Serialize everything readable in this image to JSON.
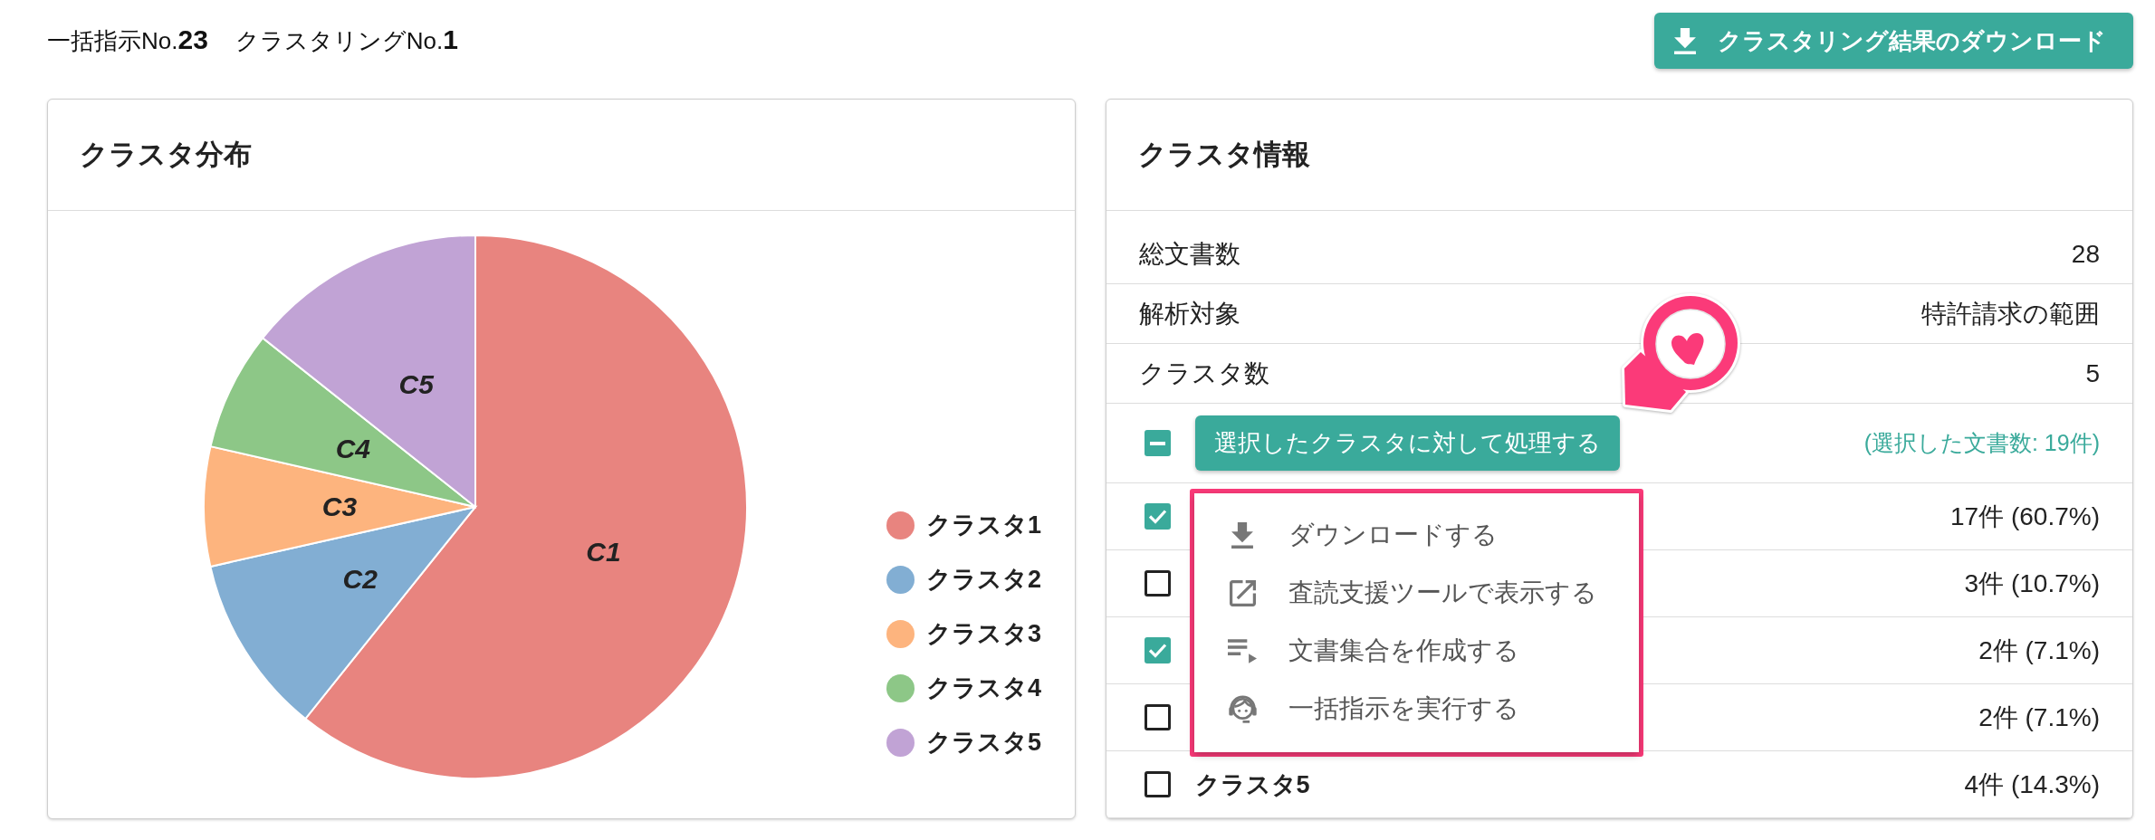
{
  "header": {
    "batch_label": "一括指示No.**23**",
    "clustering_label": "クラスタリングNo.**1**",
    "download_button": {
      "label": "クラスタリング結果のダウンロード"
    }
  },
  "distribution": {
    "title": "クラスタ分布",
    "chart_data": {
      "type": "pie",
      "categories": [
        "C1",
        "C2",
        "C3",
        "C4",
        "C5"
      ],
      "values": [
        60.7,
        10.7,
        7.1,
        7.1,
        14.3
      ]
    },
    "legend": [
      {
        "label": "クラスタ1",
        "color": "#e8847f"
      },
      {
        "label": "クラスタ2",
        "color": "#82aed3"
      },
      {
        "label": "クラスタ3",
        "color": "#fdb47e"
      },
      {
        "label": "クラスタ4",
        "color": "#8dc787"
      },
      {
        "label": "クラスタ5",
        "color": "#c1a3d5"
      }
    ]
  },
  "info": {
    "title": "クラスタ情報",
    "stats": [
      {
        "label": "総文書数",
        "value": "28"
      },
      {
        "label": "解析対象",
        "value": "特許請求の範囲"
      },
      {
        "label": "クラスタ数",
        "value": "5"
      }
    ],
    "select_all": {
      "indeterminate": true
    },
    "action_button": {
      "label": "選択したクラスタに対して処理する"
    },
    "selected_count": "(選択した文書数: 19件)",
    "clusters": [
      {
        "checked": true,
        "count": "17件 (60.7%)"
      },
      {
        "checked": false,
        "count": "3件 (10.7%)"
      },
      {
        "checked": true,
        "count": "2件 (7.1%)"
      },
      {
        "checked": false,
        "count": "2件 (7.1%)"
      },
      {
        "name": "クラスタ5",
        "checked": false,
        "count": "4件 (14.3%)"
      }
    ],
    "action_menu": {
      "items": [
        {
          "kind": "download",
          "label": "ダウンロードする"
        },
        {
          "kind": "open",
          "label": "査読支援ツールで表示する"
        },
        {
          "kind": "collection",
          "label": "文書集合を作成する"
        },
        {
          "kind": "batch",
          "label": "一括指示を実行する"
        }
      ]
    }
  }
}
